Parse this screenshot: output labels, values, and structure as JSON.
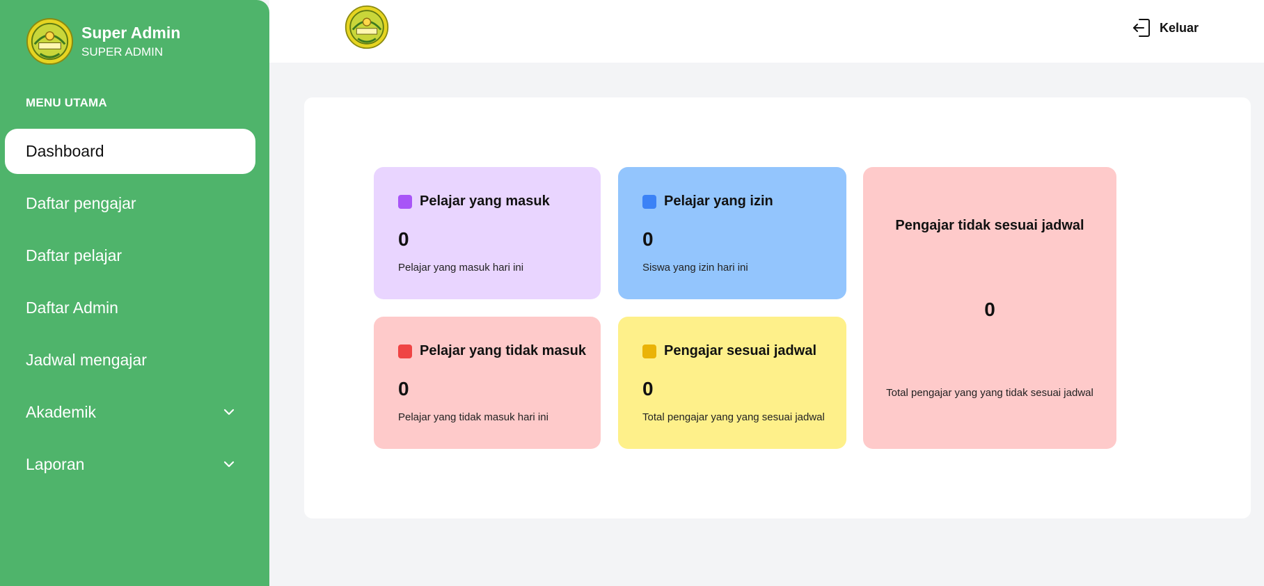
{
  "sidebar": {
    "user_name": "Super Admin",
    "user_role": "SUPER ADMIN",
    "menu_title": "MENU UTAMA",
    "items": [
      {
        "label": "Dashboard"
      },
      {
        "label": "Daftar pengajar"
      },
      {
        "label": "Daftar pelajar"
      },
      {
        "label": "Daftar Admin"
      },
      {
        "label": "Jadwal mengajar"
      },
      {
        "label": "Akademik",
        "icon": "chevron-down-icon"
      },
      {
        "label": "Laporan",
        "icon": "chevron-down-icon"
      }
    ],
    "active_item": "Dashboard",
    "bg_color": "#4fb46b"
  },
  "topbar": {
    "logout_label": "Keluar",
    "logout_icon": "logout-icon"
  },
  "cards": {
    "students_present": {
      "title": "Pelajar yang masuk",
      "value": "0",
      "desc": "Pelajar yang masuk hari ini",
      "color": "#e9d5ff",
      "accent": "#a855f7"
    },
    "students_permission": {
      "title": "Pelajar yang izin",
      "value": "0",
      "desc": "Siswa yang izin hari ini",
      "color": "#93c5fd",
      "accent": "#3b82f6"
    },
    "students_absent": {
      "title": "Pelajar yang tidak masuk",
      "value": "0",
      "desc": "Pelajar yang tidak masuk hari ini",
      "color": "#fecaca",
      "accent": "#ef4444"
    },
    "teachers_on_schedule": {
      "title": "Pengajar sesuai jadwal",
      "value": "0",
      "desc": "Total pengajar yang yang sesuai jadwal",
      "color": "#fef08a",
      "accent": "#eab308"
    },
    "teachers_off_schedule": {
      "title": "Pengajar tidak sesuai jadwal",
      "value": "0",
      "desc": "Total pengajar yang yang tidak sesuai jadwal",
      "color": "#fecaca"
    }
  }
}
